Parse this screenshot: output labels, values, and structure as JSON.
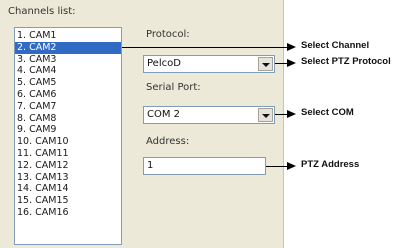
{
  "channels_label": "Channels list:",
  "channels": [
    {
      "label": "1. CAM1",
      "selected": false
    },
    {
      "label": "2. CAM2",
      "selected": true
    },
    {
      "label": "3. CAM3",
      "selected": false
    },
    {
      "label": "4. CAM4",
      "selected": false
    },
    {
      "label": "5. CAM5",
      "selected": false
    },
    {
      "label": "6. CAM6",
      "selected": false
    },
    {
      "label": "7. CAM7",
      "selected": false
    },
    {
      "label": "8. CAM8",
      "selected": false
    },
    {
      "label": "9. CAM9",
      "selected": false
    },
    {
      "label": "10. CAM10",
      "selected": false
    },
    {
      "label": "11. CAM11",
      "selected": false
    },
    {
      "label": "12. CAM12",
      "selected": false
    },
    {
      "label": "13. CAM13",
      "selected": false
    },
    {
      "label": "14. CAM14",
      "selected": false
    },
    {
      "label": "15. CAM15",
      "selected": false
    },
    {
      "label": "16. CAM16",
      "selected": false
    }
  ],
  "protocol": {
    "label": "Protocol:",
    "value": "PelcoD"
  },
  "serial_port": {
    "label": "Serial Port:",
    "value": "COM 2"
  },
  "address": {
    "label": "Address:",
    "value": "1"
  },
  "callouts": {
    "select_channel": "Select Channel",
    "select_ptz_protocol": "Select PTZ Protocol",
    "select_com": "Select COM",
    "ptz_address": "PTZ Address"
  }
}
